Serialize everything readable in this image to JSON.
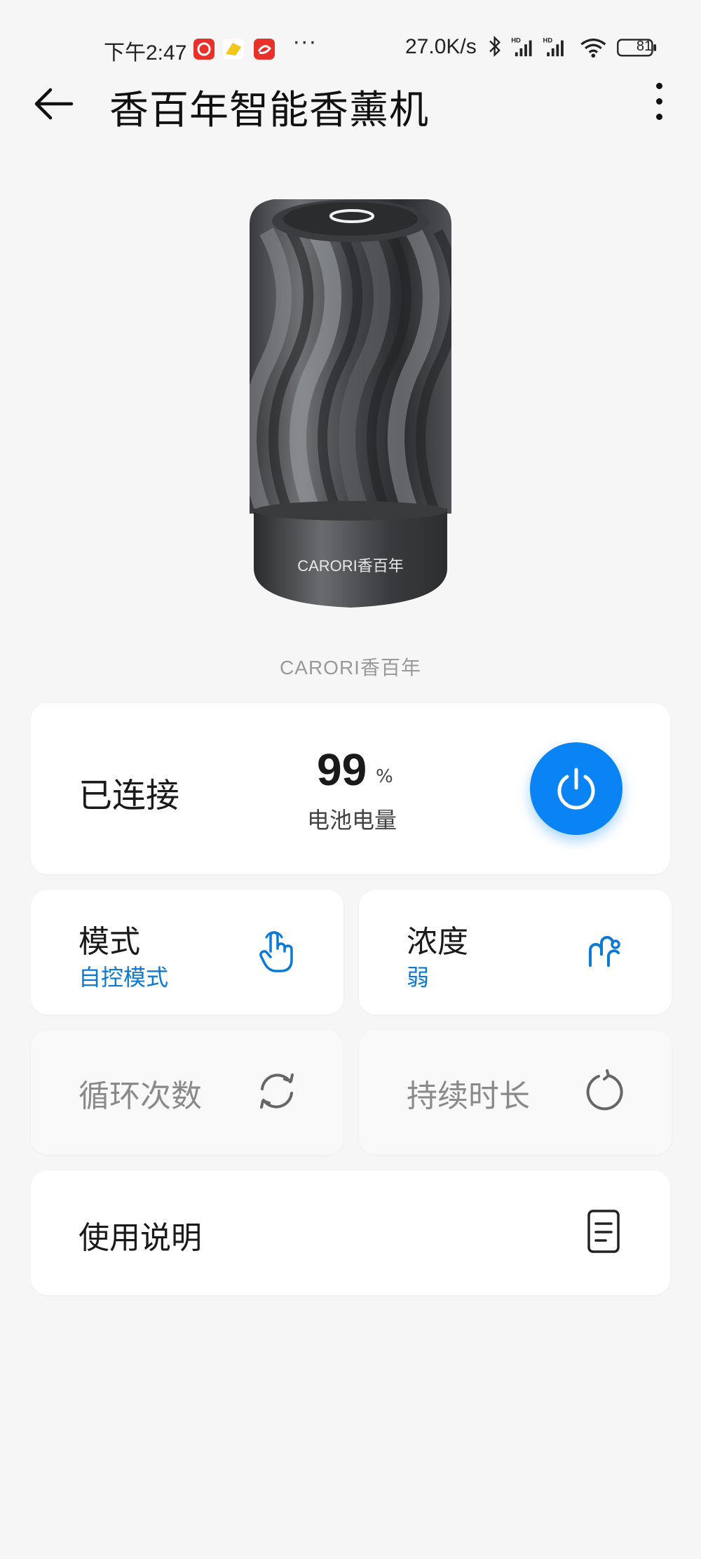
{
  "status_bar": {
    "time": "下午2:47",
    "more": "···",
    "speed": "27.0K/s",
    "battery": "81",
    "icons": [
      "app-icon-red",
      "app-icon-yellow",
      "app-icon-red",
      "bluetooth-icon",
      "hd-signal-icon",
      "hd-signal-icon",
      "wifi-icon",
      "battery-icon"
    ]
  },
  "app_bar": {
    "title": "香百年智能香薰机"
  },
  "product": {
    "logo_text": "CARORI香百年",
    "caption": "CARORI香百年"
  },
  "status_card": {
    "connection": "已连接",
    "battery_value": "99",
    "battery_unit": "%",
    "battery_label": "电池电量"
  },
  "mode_card": {
    "title": "模式",
    "value": "自控模式"
  },
  "concentration_card": {
    "title": "浓度",
    "value": "弱"
  },
  "cycle_card": {
    "title": "循环次数"
  },
  "duration_card": {
    "title": "持续时长"
  },
  "guide_card": {
    "title": "使用说明"
  },
  "colors": {
    "accent": "#0a84f5",
    "link": "#0a7ad6",
    "background": "#f6f6f6"
  }
}
